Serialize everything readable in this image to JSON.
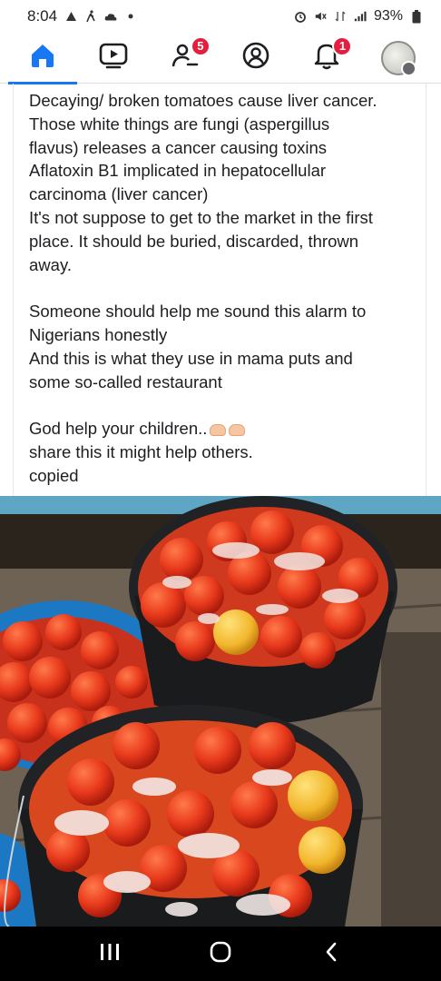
{
  "status_bar": {
    "time": "8:04",
    "battery": "93%"
  },
  "nav": {
    "items": [
      {
        "name": "home",
        "icon": "home-icon",
        "active": true
      },
      {
        "name": "watch",
        "icon": "video-icon"
      },
      {
        "name": "friends",
        "icon": "friends-icon",
        "badge": "5"
      },
      {
        "name": "profile",
        "icon": "profile-icon"
      },
      {
        "name": "notifications",
        "icon": "bell-icon",
        "badge": "1"
      },
      {
        "name": "menu",
        "icon": "avatar-icon"
      }
    ],
    "accent_color": "#1877f2",
    "badge_color": "#e41e3f"
  },
  "post": {
    "lines": [
      "Decaying/ broken tomatoes cause liver cancer.",
      "Those white things are fungi  (aspergillus",
      "flavus) releases a cancer causing toxins",
      "Aflatoxin B1 implicated in hepatocellular",
      "carcinoma (liver cancer)",
      "It's not suppose to get to the market in the first",
      "place. It should be buried, discarded, thrown",
      "away.",
      "",
      "Someone should help me sound this alarm to",
      "Nigerians honestly",
      "And this is what they use in mama puts and",
      "some so-called restaurant",
      "",
      " God help your children..",
      "share this it might help others.",
      "copied"
    ]
  },
  "photo": {
    "subject": "buckets of rotting tomatoes with white mold"
  },
  "system_nav": {
    "buttons": [
      "recents-icon",
      "home-circle-icon",
      "back-icon"
    ]
  }
}
